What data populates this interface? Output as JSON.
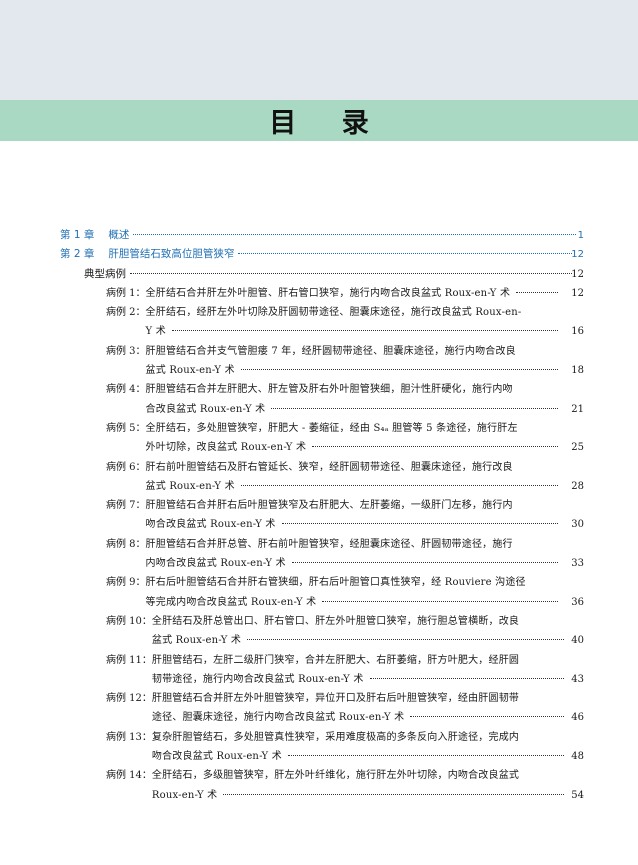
{
  "title": "目 录",
  "chapters": [
    {
      "num": "第 1 章",
      "title": "概述",
      "page": "1"
    },
    {
      "num": "第 2 章",
      "title": "肝胆管结石致高位胆管狭窄",
      "page": "12"
    }
  ],
  "section": {
    "title": "典型病例",
    "page": "12"
  },
  "cases": [
    {
      "label": "病例 1：",
      "lines": [
        "全肝结石合并肝左外叶胆管、肝右管口狭窄，施行内吻合改良盆式 Roux-en-Y 术"
      ],
      "page": "12"
    },
    {
      "label": "病例 2：",
      "lines": [
        "全肝结石，经肝左外叶切除及肝圆韧带途径、胆囊床途径，施行改良盆式 Roux-en-",
        "Y 术"
      ],
      "page": "16"
    },
    {
      "label": "病例 3：",
      "lines": [
        "肝胆管结石合并支气管胆瘘 7 年，经肝圆韧带途径、胆囊床途径，施行内吻合改良",
        "盆式 Roux-en-Y 术"
      ],
      "page": "18"
    },
    {
      "label": "病例 4：",
      "lines": [
        "肝胆管结石合并左肝肥大、肝左管及肝右外叶胆管狭细，胆汁性肝硬化，施行内吻",
        "合改良盆式 Roux-en-Y 术"
      ],
      "page": "21"
    },
    {
      "label": "病例 5：",
      "lines": [
        "全肝结石，多处胆管狭窄，肝肥大 - 萎缩征，经由 S₄ₐ 胆管等 5 条途径，施行肝左",
        "外叶切除，改良盆式 Roux-en-Y 术"
      ],
      "page": "25"
    },
    {
      "label": "病例 6：",
      "lines": [
        "肝右前叶胆管结石及肝右管延长、狭窄，经肝圆韧带途径、胆囊床途径，施行改良",
        "盆式 Roux-en-Y 术"
      ],
      "page": "28"
    },
    {
      "label": "病例 7：",
      "lines": [
        "肝胆管结石合并肝右后叶胆管狭窄及右肝肥大、左肝萎缩，一级肝门左移，施行内",
        "吻合改良盆式 Roux-en-Y 术"
      ],
      "page": "30"
    },
    {
      "label": "病例 8：",
      "lines": [
        "肝胆管结石合并肝总管、肝右前叶胆管狭窄，经胆囊床途径、肝圆韧带途径，施行",
        "内吻合改良盆式 Roux-en-Y 术"
      ],
      "page": "33"
    },
    {
      "label": "病例 9：",
      "lines": [
        "肝右后叶胆管结石合并肝右管狭细，肝右后叶胆管口真性狭窄，经 Rouviere 沟途径",
        "等完成内吻合改良盆式 Roux-en-Y 术"
      ],
      "page": "36"
    },
    {
      "label": "病例 10：",
      "lines": [
        "全肝结石及肝总管出口、肝右管口、肝左外叶胆管口狭窄，施行胆总管横断，改良",
        "盆式 Roux-en-Y 术"
      ],
      "page": "40"
    },
    {
      "label": "病例 11：",
      "lines": [
        "肝胆管结石，左肝二级肝门狭窄，合并左肝肥大、右肝萎缩，肝方叶肥大，经肝圆",
        "韧带途径，施行内吻合改良盆式 Roux-en-Y 术"
      ],
      "page": "43"
    },
    {
      "label": "病例 12：",
      "lines": [
        "肝胆管结石合并肝左外叶胆管狭窄，异位开口及肝右后叶胆管狭窄，经由肝圆韧带",
        "途径、胆囊床途径，施行内吻合改良盆式 Roux-en-Y 术"
      ],
      "page": "46"
    },
    {
      "label": "病例 13：",
      "lines": [
        "复杂肝胆管结石，多处胆管真性狭窄，采用难度极高的多条反向入肝途径，完成内",
        "吻合改良盆式 Roux-en-Y 术"
      ],
      "page": "48"
    },
    {
      "label": "病例 14：",
      "lines": [
        "全肝结石，多级胆管狭窄，肝左外叶纤维化，施行肝左外叶切除，内吻合改良盆式",
        "Roux-en-Y 术"
      ],
      "page": "54"
    }
  ]
}
